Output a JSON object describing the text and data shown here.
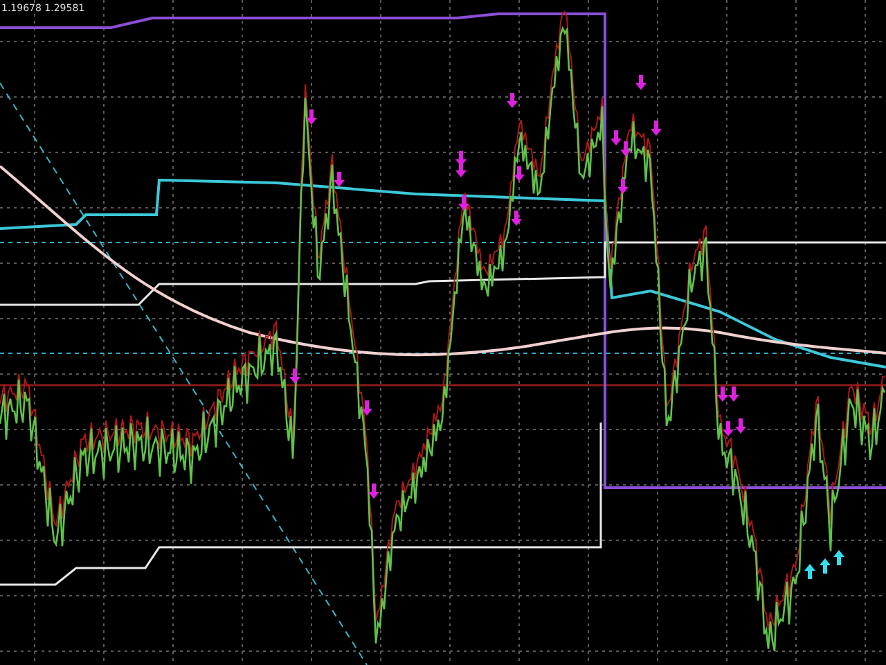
{
  "chart": {
    "price_label": "1.19678 1.29581"
  }
}
